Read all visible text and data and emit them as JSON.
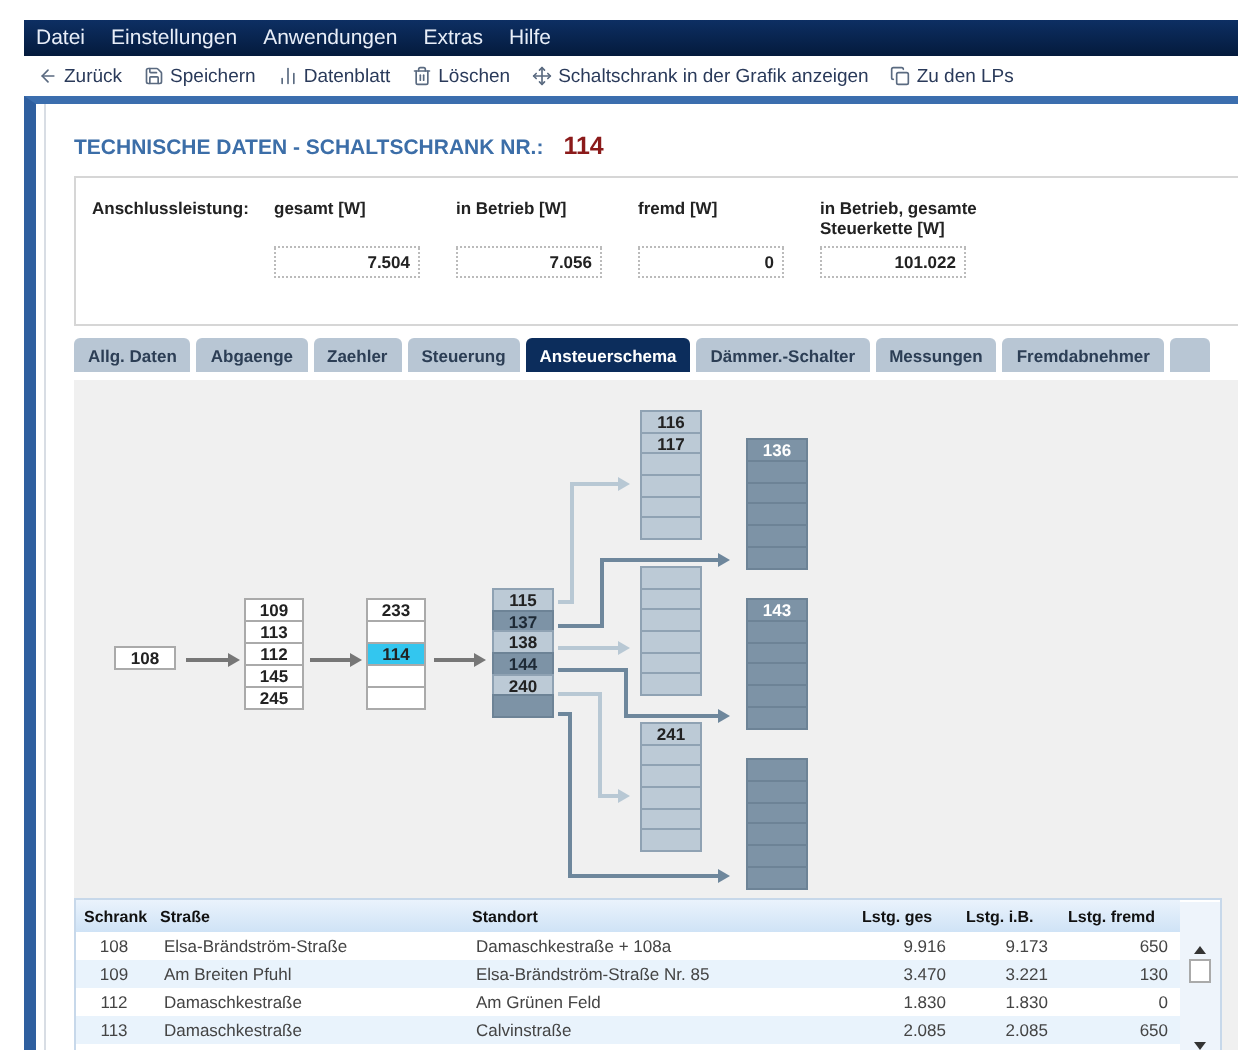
{
  "menu": [
    "Datei",
    "Einstellungen",
    "Anwendungen",
    "Extras",
    "Hilfe"
  ],
  "toolbar": [
    {
      "label": "Zurück",
      "kind": "back"
    },
    {
      "label": "Speichern",
      "kind": "save"
    },
    {
      "label": "Datenblatt",
      "kind": "sheet"
    },
    {
      "label": "Löschen",
      "kind": "delete"
    },
    {
      "label": "Schaltschrank in der Grafik anzeigen",
      "kind": "locate"
    },
    {
      "label": "Zu den LPs",
      "kind": "link"
    }
  ],
  "title": {
    "text": "TECHNISCHE DATEN - SCHALTSCHRANK NR.:",
    "number": "114"
  },
  "power": {
    "label": "Anschlussleistung:",
    "fields": [
      {
        "label": "gesamt [W]",
        "value": "7.504"
      },
      {
        "label": "in Betrieb [W]",
        "value": "7.056"
      },
      {
        "label": "fremd [W]",
        "value": "0"
      },
      {
        "label": "in Betrieb, gesamte Steuerkette [W]",
        "value": "101.022"
      }
    ]
  },
  "tabs": [
    {
      "label": "Allg. Daten",
      "selected": false
    },
    {
      "label": "Abgaenge",
      "selected": false
    },
    {
      "label": "Zaehler",
      "selected": false
    },
    {
      "label": "Steuerung",
      "selected": false
    },
    {
      "label": "Ansteuerschema",
      "selected": true
    },
    {
      "label": "Dämmer.-Schalter",
      "selected": false
    },
    {
      "label": "Messungen",
      "selected": false
    },
    {
      "label": "Fremdabnehmer",
      "selected": false
    }
  ],
  "diagram": {
    "columns": [
      {
        "cells": [
          {
            "label": "108",
            "kind": "plain",
            "selected": false
          }
        ]
      },
      {
        "cells": [
          {
            "label": "109",
            "kind": "plain",
            "selected": false
          },
          {
            "label": "113",
            "kind": "plain",
            "selected": false
          },
          {
            "label": "112",
            "kind": "plain",
            "selected": false
          },
          {
            "label": "145",
            "kind": "plain",
            "selected": false
          },
          {
            "label": "245",
            "kind": "plain",
            "selected": false
          }
        ]
      },
      {
        "cells": [
          {
            "label": "233",
            "kind": "plain",
            "selected": false
          },
          {
            "kind": "plain",
            "selected": false
          },
          {
            "label": "114",
            "kind": "plain",
            "selected": true
          },
          {
            "kind": "plain",
            "selected": false
          },
          {
            "kind": "plain",
            "selected": false
          }
        ]
      },
      {
        "cells": [
          {
            "label": "115",
            "kind": "light",
            "selected": false
          },
          {
            "label": "137",
            "kind": "dark",
            "selected": false
          },
          {
            "label": "138",
            "kind": "light",
            "selected": false
          },
          {
            "label": "144",
            "kind": "dark",
            "selected": false
          },
          {
            "label": "240",
            "kind": "light",
            "selected": false
          },
          {
            "kind": "dark",
            "selected": false
          }
        ]
      },
      {
        "cells": [
          {
            "label": "116",
            "kind": "light",
            "selected": false
          },
          {
            "label": "117",
            "kind": "light",
            "selected": false
          },
          {
            "kind": "light",
            "selected": false
          },
          {
            "kind": "light",
            "selected": false
          },
          {
            "kind": "light",
            "selected": false
          },
          {
            "kind": "light",
            "selected": false
          }
        ]
      },
      {
        "cells": [
          {
            "kind": "light",
            "selected": false
          },
          {
            "kind": "light",
            "selected": false
          },
          {
            "kind": "light",
            "selected": false
          },
          {
            "kind": "light",
            "selected": false
          },
          {
            "kind": "light",
            "selected": false
          },
          {
            "kind": "light",
            "selected": false
          }
        ]
      },
      {
        "cells": [
          {
            "label": "241",
            "kind": "light",
            "selected": false
          },
          {
            "kind": "light",
            "selected": false
          },
          {
            "kind": "light",
            "selected": false
          },
          {
            "kind": "light",
            "selected": false
          },
          {
            "kind": "light",
            "selected": false
          },
          {
            "kind": "light",
            "selected": false
          }
        ]
      },
      {
        "cells": [
          {
            "label": "136",
            "kind": "dark",
            "selected": false
          },
          {
            "kind": "dark",
            "selected": false
          },
          {
            "kind": "dark",
            "selected": false
          },
          {
            "kind": "dark",
            "selected": false
          },
          {
            "kind": "dark",
            "selected": false
          },
          {
            "kind": "dark",
            "selected": false
          }
        ]
      },
      {
        "cells": [
          {
            "label": "143",
            "kind": "dark",
            "selected": false
          },
          {
            "kind": "dark",
            "selected": false
          },
          {
            "kind": "dark",
            "selected": false
          },
          {
            "kind": "dark",
            "selected": false
          },
          {
            "kind": "dark",
            "selected": false
          },
          {
            "kind": "dark",
            "selected": false
          }
        ]
      },
      {
        "cells": [
          {
            "kind": "dark",
            "selected": false
          },
          {
            "kind": "dark",
            "selected": false
          },
          {
            "kind": "dark",
            "selected": false
          },
          {
            "kind": "dark",
            "selected": false
          },
          {
            "kind": "dark",
            "selected": false
          },
          {
            "kind": "dark",
            "selected": false
          }
        ]
      }
    ]
  },
  "table": {
    "columns": [
      "Schrank",
      "Straße",
      "Standort",
      "Lstg. ges",
      "Lstg. i.B.",
      "Lstg. fremd"
    ],
    "rows": [
      [
        "108",
        "Elsa-Brändström-Straße",
        "Damaschkestraße + 108a",
        "9.916",
        "9.173",
        "650"
      ],
      [
        "109",
        "Am Breiten Pfuhl",
        "Elsa-Brändström-Straße Nr. 85",
        "3.470",
        "3.221",
        "130"
      ],
      [
        "112",
        "Damaschkestraße",
        "Am Grünen Feld",
        "1.830",
        "1.830",
        "0"
      ],
      [
        "113",
        "Damaschkestraße",
        "Calvinstraße",
        "2.085",
        "2.085",
        "650"
      ]
    ]
  }
}
